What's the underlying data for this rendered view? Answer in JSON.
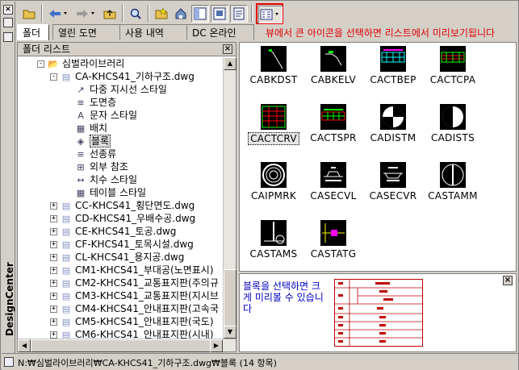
{
  "window": {
    "title": "DesignCenter"
  },
  "toolbar": {
    "hint": "뷰에서 큰 아이콘을 선택하면 리스트에서 미리보기됩니다"
  },
  "tabs": [
    {
      "label": "폴더"
    },
    {
      "label": "열린 도면"
    },
    {
      "label": "사용 내역"
    },
    {
      "label": "DC 온라인"
    }
  ],
  "tree": {
    "header": "폴더 리스트",
    "nodes": [
      {
        "label": "심벌라이브러리",
        "icon": "folder-icon"
      },
      {
        "label": "CA-KHCS41_기하구조.dwg",
        "icon": "dwg-icon"
      },
      {
        "label": "다중 지시선 스타일",
        "icon": "mleader-icon"
      },
      {
        "label": "도면층",
        "icon": "layers-icon"
      },
      {
        "label": "문자 스타일",
        "icon": "text-style-icon"
      },
      {
        "label": "배치",
        "icon": "layout-icon"
      },
      {
        "label": "블록",
        "icon": "block-icon"
      },
      {
        "label": "선종류",
        "icon": "linetype-icon"
      },
      {
        "label": "외부 참조",
        "icon": "xref-icon"
      },
      {
        "label": "치수 스타일",
        "icon": "dimstyle-icon"
      },
      {
        "label": "테이블 스타일",
        "icon": "table-style-icon"
      },
      {
        "label": "CC-KHCS41_횡단면도.dwg",
        "icon": "dwg-icon"
      },
      {
        "label": "CD-KHCS41_우배수공.dwg",
        "icon": "dwg-icon"
      },
      {
        "label": "CE-KHCS41_토공.dwg",
        "icon": "dwg-icon"
      },
      {
        "label": "CF-KHCS41_토목시설.dwg",
        "icon": "dwg-icon"
      },
      {
        "label": "CL-KHCS41_용지공.dwg",
        "icon": "dwg-icon"
      },
      {
        "label": "CM1-KHCS41_부대공(노면표시)",
        "icon": "dwg-icon"
      },
      {
        "label": "CM2-KHCS41_교통표지판(주의규",
        "icon": "dwg-icon"
      },
      {
        "label": "CM3-KHCS41_교통표지판(지시브",
        "icon": "dwg-icon"
      },
      {
        "label": "CM4-KHCS41_안내표지판(고속국",
        "icon": "dwg-icon"
      },
      {
        "label": "CM5-KHCS41_안내표지판(국도)",
        "icon": "dwg-icon"
      },
      {
        "label": "CM6-KHCS41_안내표지판(시내)",
        "icon": "dwg-icon"
      }
    ]
  },
  "blocks": [
    {
      "name": "CABKDST"
    },
    {
      "name": "CABKELV"
    },
    {
      "name": "CACTBEP"
    },
    {
      "name": "CACTCPA"
    },
    {
      "name": "CACTCRV"
    },
    {
      "name": "CACTSPR"
    },
    {
      "name": "CADISTM"
    },
    {
      "name": "CADISTS"
    },
    {
      "name": "CAIPMRK"
    },
    {
      "name": "CASECVL"
    },
    {
      "name": "CASECVR"
    },
    {
      "name": "CASTAMM"
    },
    {
      "name": "CASTAMS"
    },
    {
      "name": "CASTATG"
    }
  ],
  "preview": {
    "message": "블록을 선택하면 크게 미리볼 수 있습니다"
  },
  "status": {
    "path": "N:₩심벌라이브러리₩CA-KHCS41_기하구조.dwg₩블록 (14 항목)"
  }
}
